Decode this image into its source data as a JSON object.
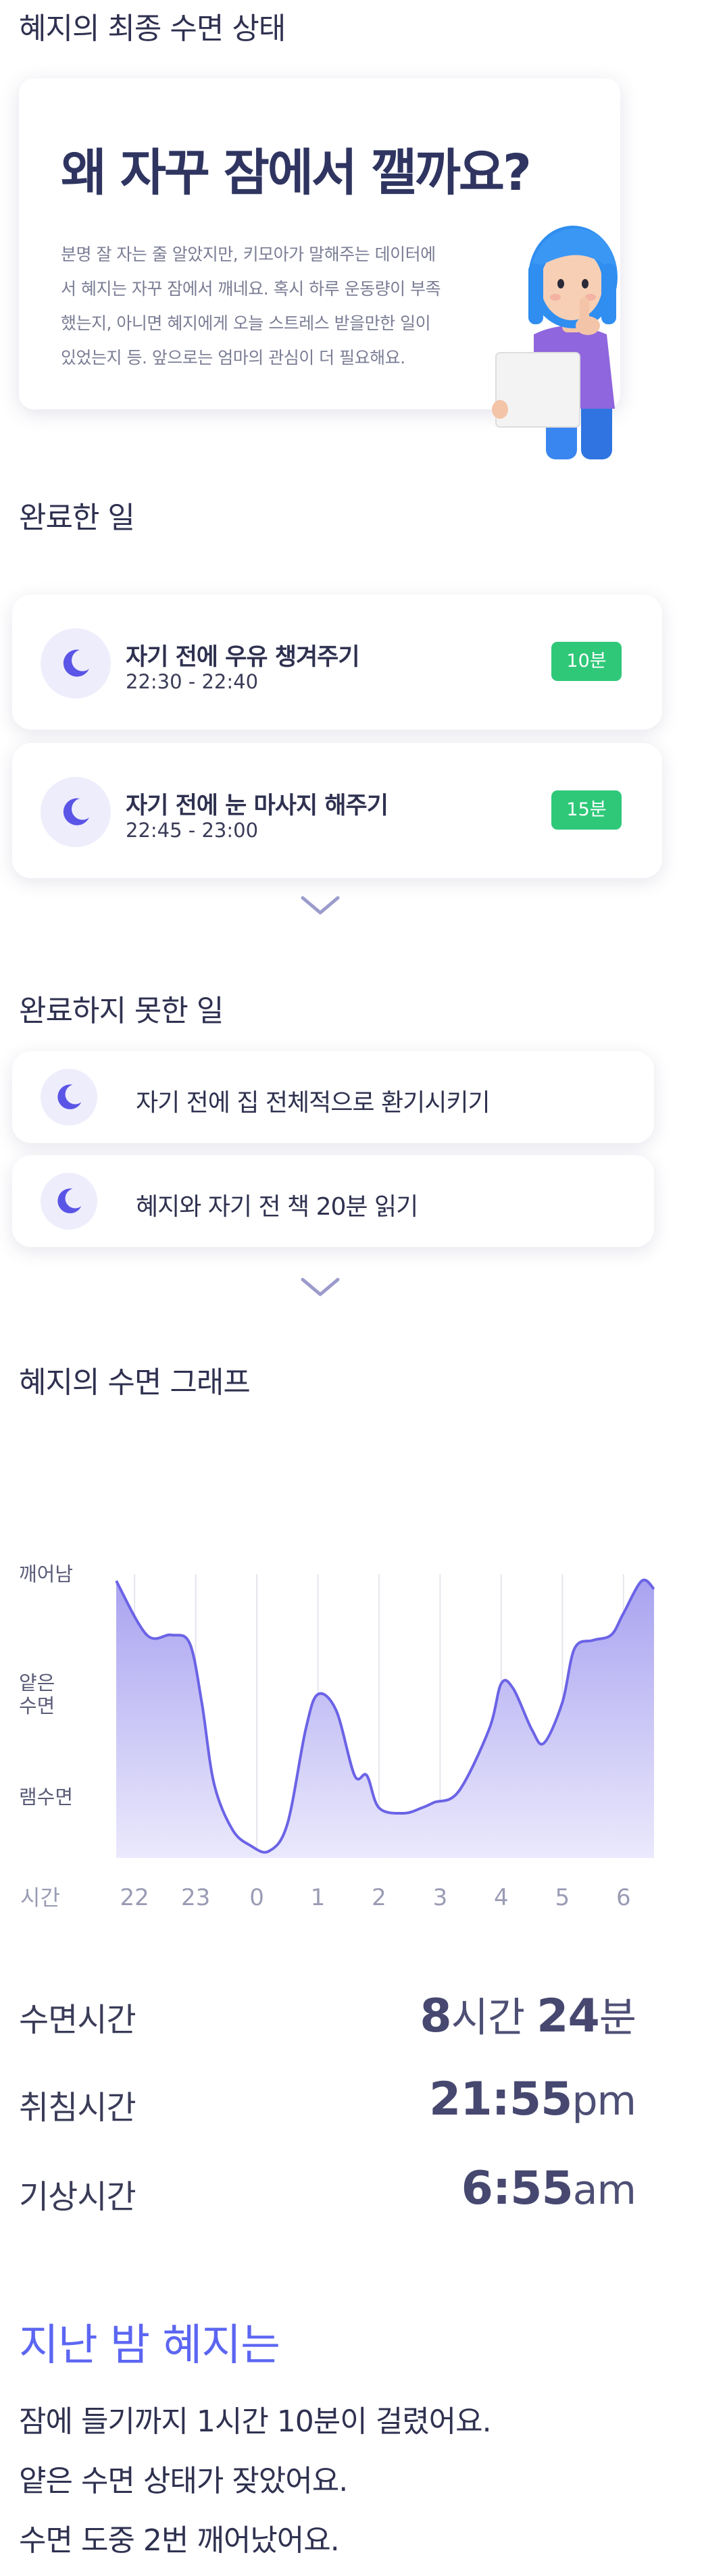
{
  "header": {
    "title": "혜지의 최종 수면 상태"
  },
  "hero": {
    "title": "왜 자꾸 잠에서 깰까요?",
    "body_lines": [
      "분명 잘 자는 줄 알았지만, 키모아가 말해주는 데이터에",
      "서 혜지는 자꾸 잠에서 깨네요. 혹시 하루 운동량이 부족",
      "했는지, 아니면 혜지에게 오늘 스트레스 받을만한 일이",
      "있었는지 등. 앞으로는 엄마의 관심이 더 필요해요."
    ]
  },
  "completed": {
    "title": "완료한 일",
    "items": [
      {
        "title": "자기 전에 우유 챙겨주기",
        "time": "22:30 - 22:40",
        "badge": "10분"
      },
      {
        "title": "자기 전에 눈 마사지 해주기",
        "time": "22:45 - 23:00",
        "badge": "15분"
      }
    ]
  },
  "incomplete": {
    "title": "완료하지 못한 일",
    "items": [
      {
        "label": "자기 전에 집 전체적으로 환기시키기"
      },
      {
        "label": "혜지와 자기 전 책 20분 읽기"
      }
    ]
  },
  "graph": {
    "title": "혜지의 수면 그래프"
  },
  "chart_data": {
    "type": "area",
    "y_categories": [
      "깨어남",
      "얕은 수면",
      "램수면"
    ],
    "x_label": "시간",
    "x_ticks": [
      "22",
      "23",
      "0",
      "1",
      "2",
      "3",
      "4",
      "5",
      "6"
    ],
    "series": [
      {
        "x_hours": [
          21.7,
          22.2,
          22.6,
          22.9,
          23.1,
          23.3,
          23.6,
          23.9,
          24.2,
          24.5,
          24.8,
          25.0,
          25.3,
          25.6,
          25.8,
          26.0,
          26.4,
          26.7,
          26.9,
          27.3,
          27.8,
          28.0,
          28.2,
          28.5,
          28.7,
          29.0,
          29.2,
          29.5,
          29.8,
          30.0,
          30.3,
          30.5
        ],
        "level": [
          1.0,
          0.8,
          0.8,
          0.77,
          0.55,
          0.25,
          0.08,
          0.02,
          0.0,
          0.1,
          0.45,
          0.58,
          0.52,
          0.28,
          0.28,
          0.16,
          0.14,
          0.16,
          0.18,
          0.22,
          0.45,
          0.62,
          0.6,
          0.45,
          0.4,
          0.55,
          0.75,
          0.78,
          0.8,
          0.88,
          1.0,
          0.97
        ]
      }
    ],
    "colors": {
      "line": "#6b63e6",
      "fill_top": "#a9a3f0",
      "fill_bottom": "#ebe9fc"
    }
  },
  "stats": {
    "sleep_time": {
      "label": "수면시간",
      "hours": "8",
      "hours_unit": "시간",
      "minutes": "24",
      "minutes_unit": "분"
    },
    "bed_time": {
      "label": "취침시간",
      "time": "21:55",
      "suffix": "pm"
    },
    "wake_time": {
      "label": "기상시간",
      "time": "6:55",
      "suffix": "am"
    }
  },
  "recap": {
    "title": "지난 밤 혜지는",
    "lines": [
      "잠에 들기까지 1시간 10분이 걸렸어요.",
      "얕은 수면 상태가 잦았어요.",
      "수면 도중 2번 깨어났어요."
    ]
  },
  "theme": {
    "accent": "#5c66f2",
    "badge_green": "#2fc879",
    "moon_purple": "#5a55e6"
  }
}
